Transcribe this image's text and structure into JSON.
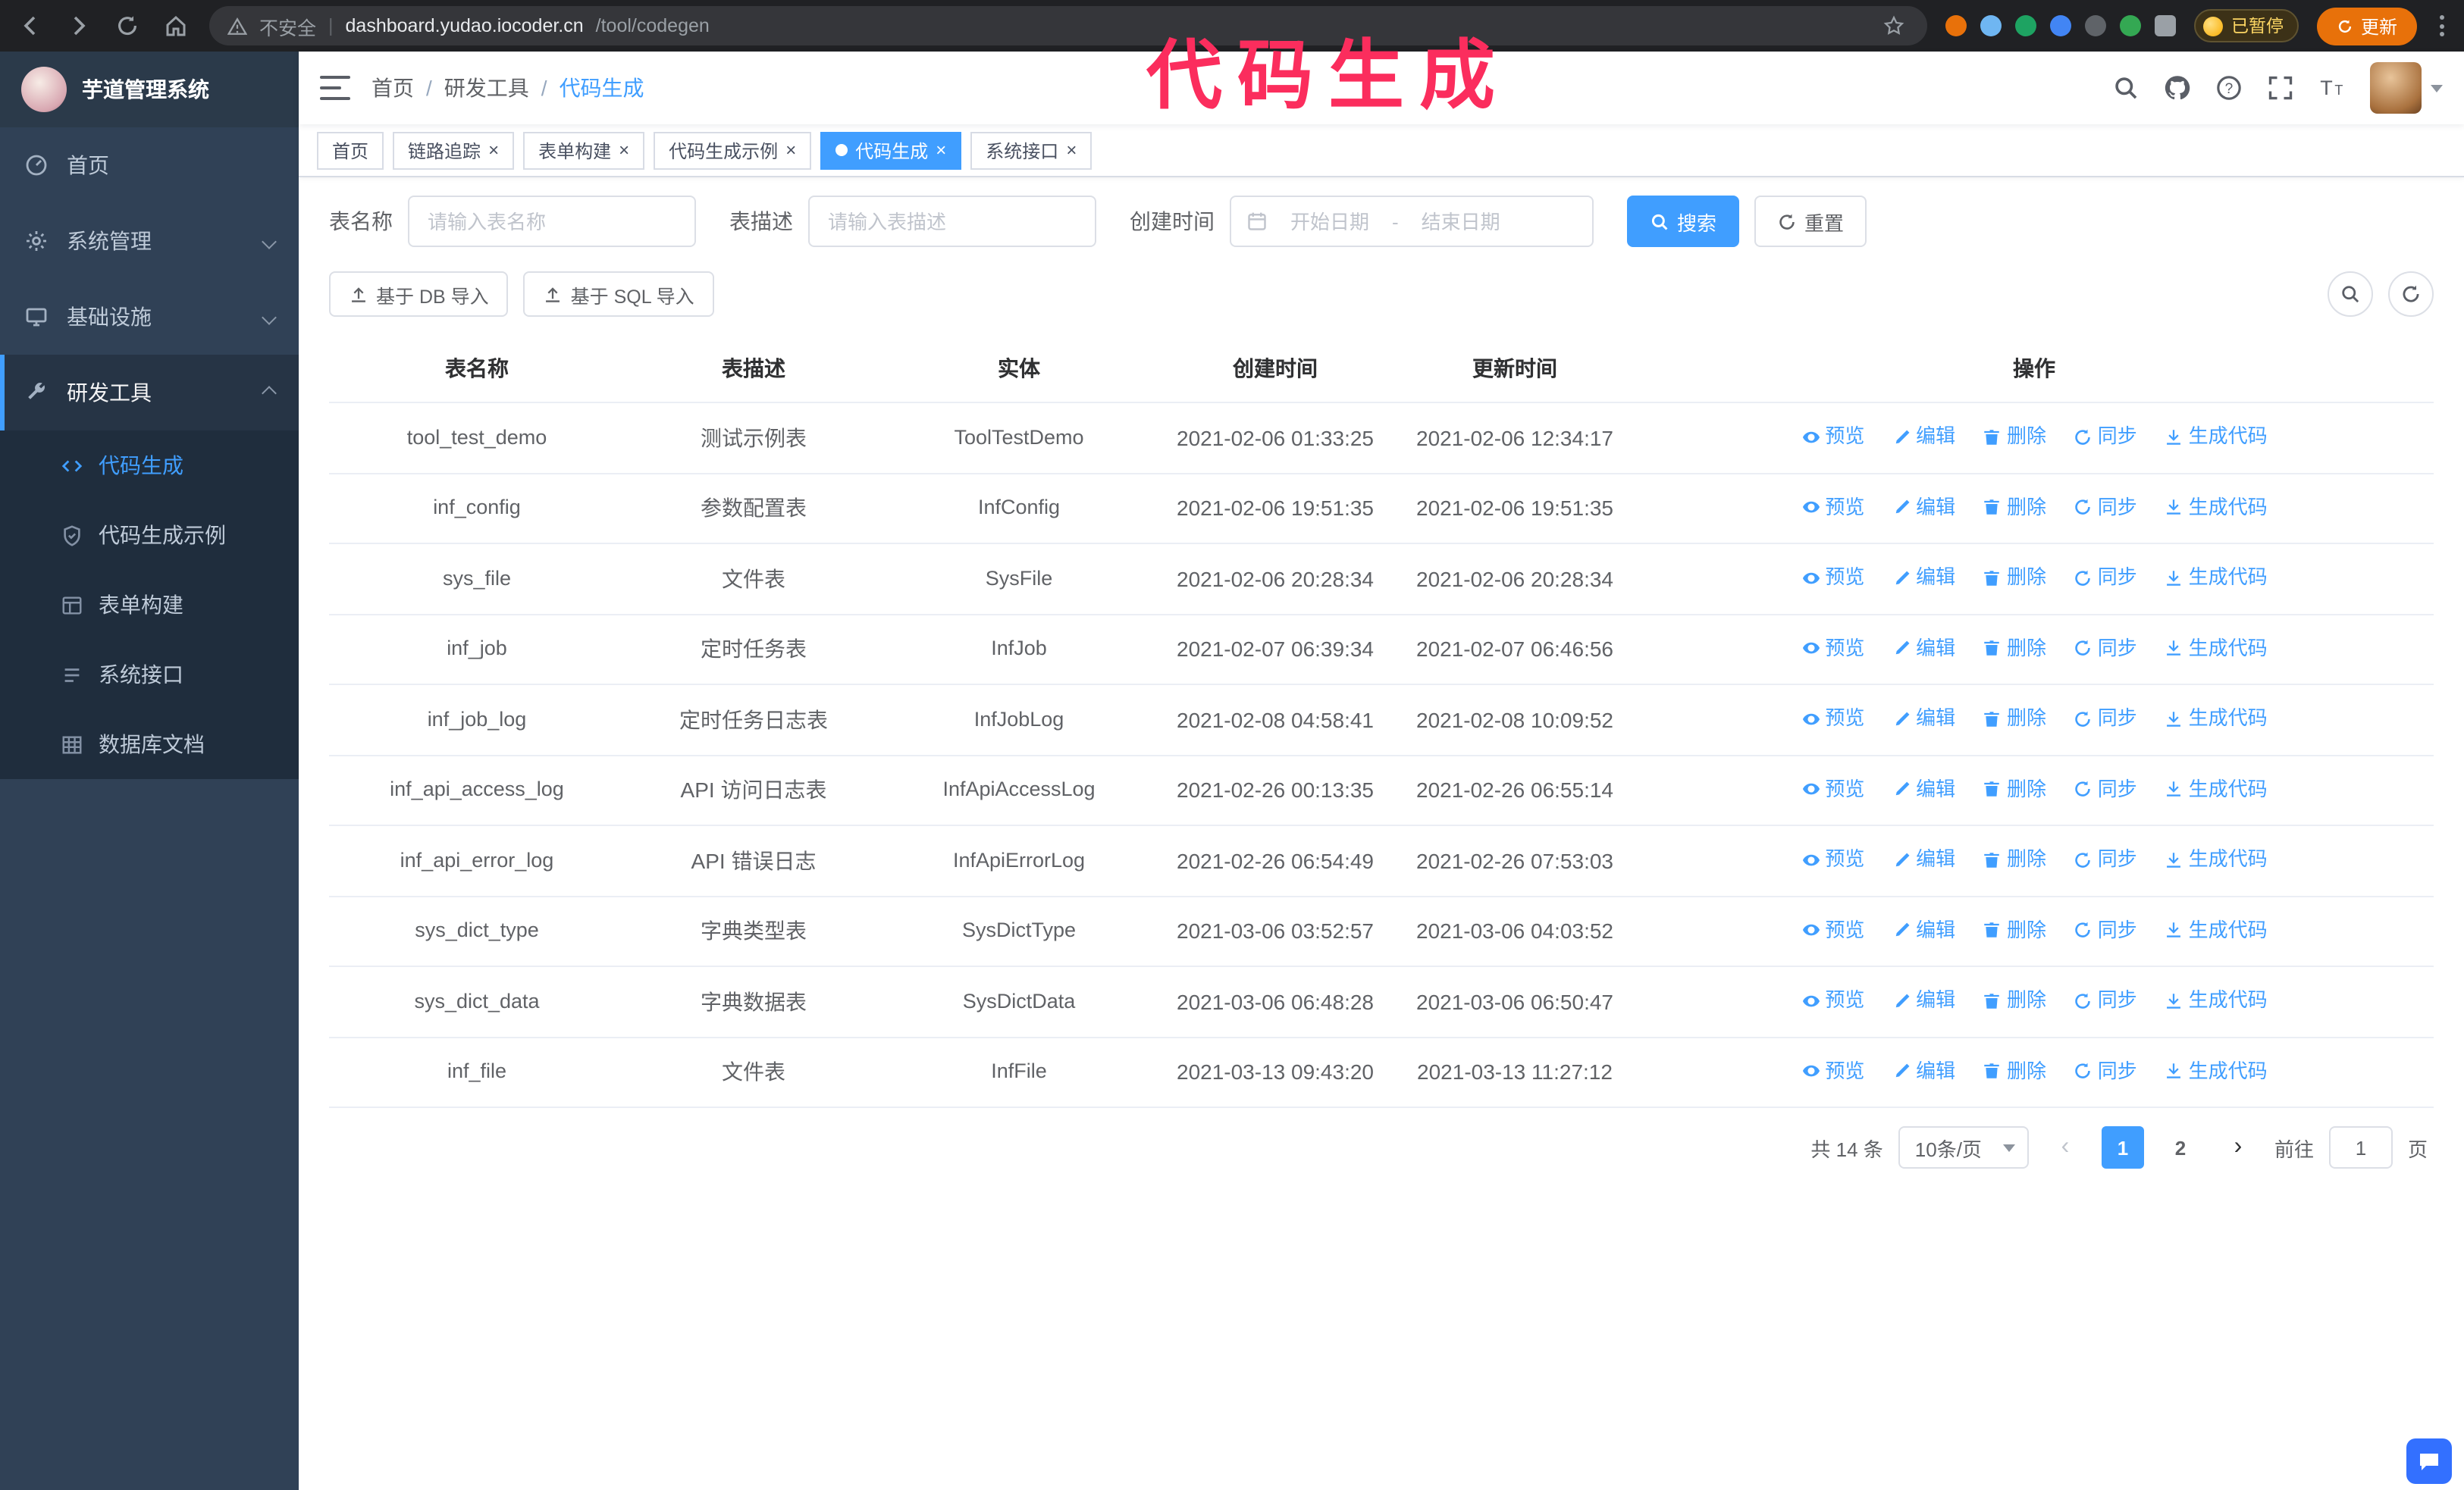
{
  "colors": {
    "accent": "#409eff",
    "annotation": "#fb2d5d",
    "sidebar_bg": "#304156",
    "submenu_bg": "#1f2d3d"
  },
  "annotation": {
    "text": "代码生成"
  },
  "browser": {
    "security_label": "不安全",
    "url_host": "dashboard.yudao.iocoder.cn",
    "url_path": "/tool/codegen",
    "paused_badge": "已暂停",
    "update_button": "更新"
  },
  "icons": {
    "close": "×",
    "prev": "‹",
    "next": "›"
  },
  "sidebar": {
    "logo_title": "芋道管理系统",
    "items": [
      {
        "label": "首页"
      },
      {
        "label": "系统管理"
      },
      {
        "label": "基础设施"
      },
      {
        "label": "研发工具"
      }
    ],
    "sub_items": [
      {
        "label": "代码生成"
      },
      {
        "label": "代码生成示例"
      },
      {
        "label": "表单构建"
      },
      {
        "label": "系统接口"
      },
      {
        "label": "数据库文档"
      }
    ]
  },
  "breadcrumb": {
    "separator": "/",
    "items": [
      "首页",
      "研发工具",
      "代码生成"
    ]
  },
  "tabs": [
    {
      "label": "首页"
    },
    {
      "label": "链路追踪"
    },
    {
      "label": "表单构建"
    },
    {
      "label": "代码生成示例"
    },
    {
      "label": "代码生成"
    },
    {
      "label": "系统接口"
    }
  ],
  "filters": {
    "table_name_label": "表名称",
    "table_name_placeholder": "请输入表名称",
    "table_desc_label": "表描述",
    "table_desc_placeholder": "请输入表描述",
    "create_time_label": "创建时间",
    "start_date_placeholder": "开始日期",
    "range_separator": "-",
    "end_date_placeholder": "结束日期",
    "search_button": "搜索",
    "reset_button": "重置"
  },
  "toolbar": {
    "import_db_button": "基于 DB 导入",
    "import_sql_button": "基于 SQL 导入"
  },
  "table": {
    "columns": [
      "表名称",
      "表描述",
      "实体",
      "创建时间",
      "更新时间",
      "操作"
    ],
    "actions": [
      "预览",
      "编辑",
      "删除",
      "同步",
      "生成代码"
    ],
    "rows": [
      {
        "name": "tool_test_demo",
        "desc": "测试示例表",
        "entity": "ToolTestDemo",
        "created": "2021-02-06 01:33:25",
        "updated": "2021-02-06 12:34:17"
      },
      {
        "name": "inf_config",
        "desc": "参数配置表",
        "entity": "InfConfig",
        "created": "2021-02-06 19:51:35",
        "updated": "2021-02-06 19:51:35"
      },
      {
        "name": "sys_file",
        "desc": "文件表",
        "entity": "SysFile",
        "created": "2021-02-06 20:28:34",
        "updated": "2021-02-06 20:28:34"
      },
      {
        "name": "inf_job",
        "desc": "定时任务表",
        "entity": "InfJob",
        "created": "2021-02-07 06:39:34",
        "updated": "2021-02-07 06:46:56"
      },
      {
        "name": "inf_job_log",
        "desc": "定时任务日志表",
        "entity": "InfJobLog",
        "created": "2021-02-08 04:58:41",
        "updated": "2021-02-08 10:09:52"
      },
      {
        "name": "inf_api_access_log",
        "desc": "API 访问日志表",
        "entity": "InfApiAccessLog",
        "created": "2021-02-26 00:13:35",
        "updated": "2021-02-26 06:55:14"
      },
      {
        "name": "inf_api_error_log",
        "desc": "API 错误日志",
        "entity": "InfApiErrorLog",
        "created": "2021-02-26 06:54:49",
        "updated": "2021-02-26 07:53:03"
      },
      {
        "name": "sys_dict_type",
        "desc": "字典类型表",
        "entity": "SysDictType",
        "created": "2021-03-06 03:52:57",
        "updated": "2021-03-06 04:03:52"
      },
      {
        "name": "sys_dict_data",
        "desc": "字典数据表",
        "entity": "SysDictData",
        "created": "2021-03-06 06:48:28",
        "updated": "2021-03-06 06:50:47"
      },
      {
        "name": "inf_file",
        "desc": "文件表",
        "entity": "InfFile",
        "created": "2021-03-13 09:43:20",
        "updated": "2021-03-13 11:27:12"
      }
    ]
  },
  "pagination": {
    "total_text": "共 14 条",
    "page_size": "10条/页",
    "pages": [
      "1",
      "2"
    ],
    "goto_prefix": "前往",
    "goto_value": "1",
    "goto_suffix": "页"
  }
}
